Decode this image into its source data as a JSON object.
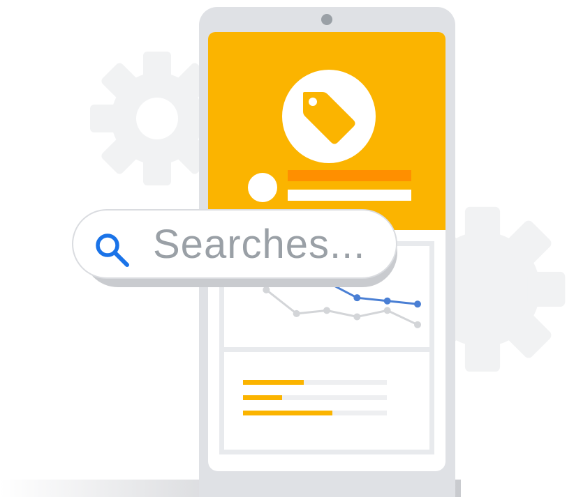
{
  "illustration": {
    "search": {
      "placeholder": "Searches...",
      "icon": "search-icon"
    },
    "hero_icon": "price-tag-icon",
    "colors": {
      "accent_yellow": "#fbb400",
      "accent_orange": "#ff8f00",
      "search_blue": "#1a73e8",
      "series_blue": "#4a7fd4",
      "series_gray": "#d3d5d8",
      "gear_gray": "#f1f2f3"
    },
    "progress_bars": [
      {
        "fraction": 0.42
      },
      {
        "fraction": 0.27
      },
      {
        "fraction": 0.62
      }
    ]
  },
  "chart_data": {
    "type": "line",
    "x": [
      1,
      2,
      3,
      4,
      5,
      6,
      7
    ],
    "series": [
      {
        "values": [
          null,
          10,
          7,
          7,
          5,
          4.6,
          4.2
        ]
      },
      {
        "values": [
          null,
          6,
          3,
          3.4,
          2.6,
          3.4,
          1.6
        ]
      }
    ],
    "grid": false
  }
}
